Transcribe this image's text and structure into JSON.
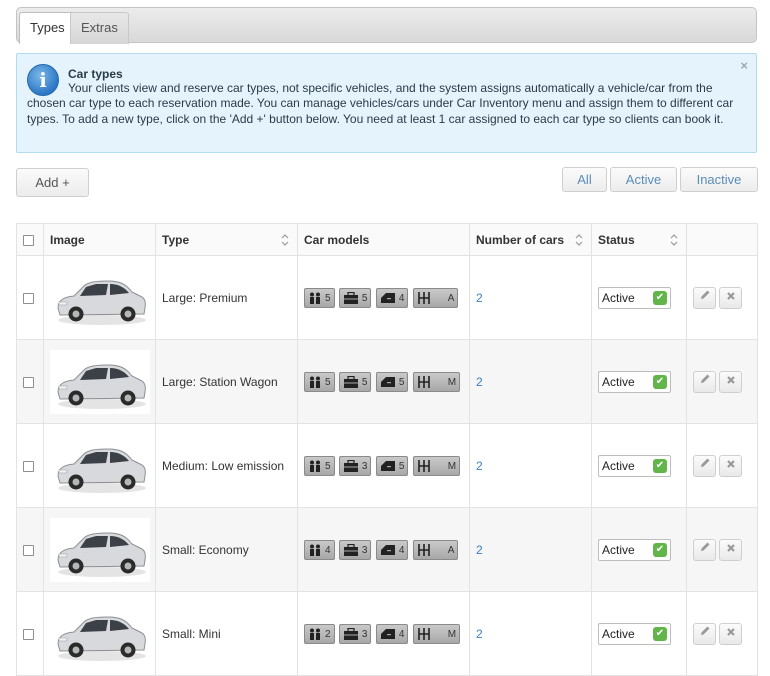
{
  "tabs": [
    {
      "label": "Types"
    },
    {
      "label": "Extras"
    }
  ],
  "info": {
    "title": "Car types",
    "text": "Your clients view and reserve car types, not specific vehicles, and the system assigns automatically a vehicle/car from the chosen car type to each reservation made. You can manage vehicles/cars under Car Inventory menu and assign them to different car types. To add a new type, click on the 'Add +' button below. You need at least 1 car assigned to each car type so clients can book it.",
    "close": "×",
    "icon": "info-icon"
  },
  "toolbar": {
    "add_label": "Add +",
    "filters": [
      "All",
      "Active",
      "Inactive"
    ]
  },
  "table": {
    "headers": [
      "Image",
      "Type",
      "Car models",
      "Number of cars",
      "Status"
    ],
    "rows": [
      {
        "type": "Large: Premium",
        "passengers": "5",
        "luggage": "5",
        "doors": "4",
        "transmission": "A",
        "count": "2",
        "status": "Active"
      },
      {
        "type": "Large: Station Wagon",
        "passengers": "5",
        "luggage": "5",
        "doors": "5",
        "transmission": "M",
        "count": "2",
        "status": "Active"
      },
      {
        "type": "Medium: Low emission",
        "passengers": "5",
        "luggage": "3",
        "doors": "5",
        "transmission": "M",
        "count": "2",
        "status": "Active"
      },
      {
        "type": "Small: Economy",
        "passengers": "4",
        "luggage": "3",
        "doors": "4",
        "transmission": "A",
        "count": "2",
        "status": "Active"
      },
      {
        "type": "Small: Mini",
        "passengers": "2",
        "luggage": "3",
        "doors": "4",
        "transmission": "M",
        "count": "2",
        "status": "Active"
      }
    ]
  },
  "colors": {
    "info_bg": "#e5f4fc",
    "link": "#3b7fc4",
    "status_ok": "#62b548"
  }
}
